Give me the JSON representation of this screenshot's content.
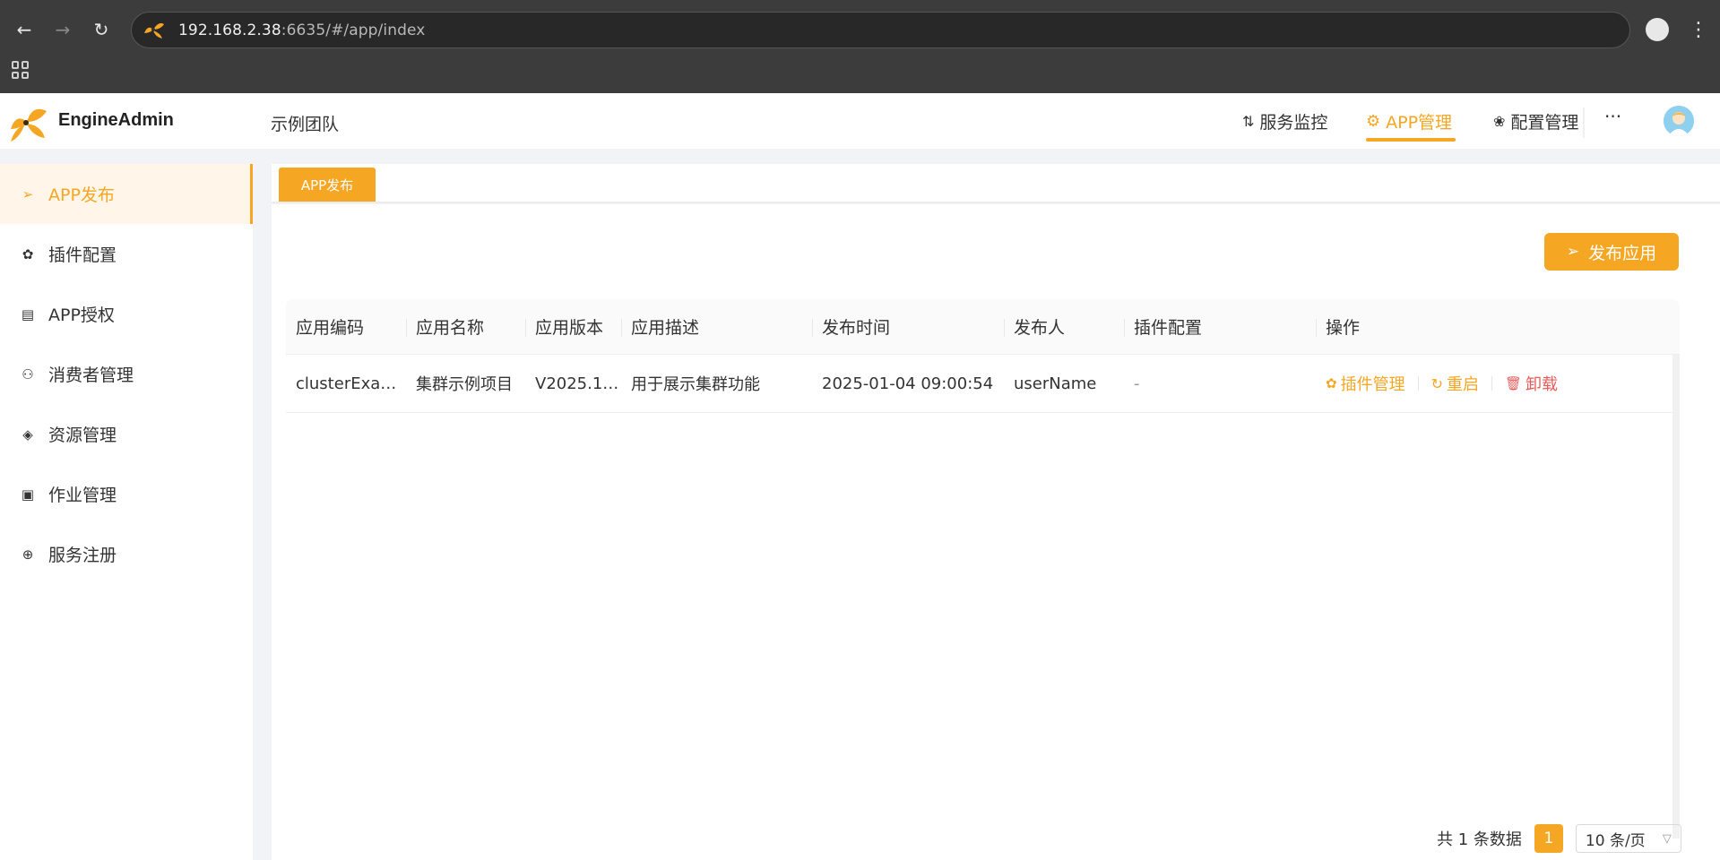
{
  "browser": {
    "url_host": "192.168.2.38",
    "url_rest": ":6635/#/app/index"
  },
  "header": {
    "brand": "EngineAdmin",
    "team": "示例团队",
    "nav": [
      {
        "label": "服务监控"
      },
      {
        "label": "APP管理"
      },
      {
        "label": "配置管理"
      }
    ],
    "more": "···"
  },
  "sidebar": {
    "items": [
      {
        "label": "APP发布",
        "icon": "send-icon"
      },
      {
        "label": "插件配置",
        "icon": "plugin-icon"
      },
      {
        "label": "APP授权",
        "icon": "license-icon"
      },
      {
        "label": "消费者管理",
        "icon": "consumer-icon"
      },
      {
        "label": "资源管理",
        "icon": "layers-icon"
      },
      {
        "label": "作业管理",
        "icon": "job-icon"
      },
      {
        "label": "服务注册",
        "icon": "user-add-icon"
      }
    ]
  },
  "tabs": {
    "active": "APP发布"
  },
  "toolbar": {
    "publish_label": "发布应用"
  },
  "table": {
    "headers": [
      "应用编码",
      "应用名称",
      "应用版本",
      "应用描述",
      "发布时间",
      "发布人",
      "插件配置",
      "操作"
    ],
    "rows": [
      {
        "code": "clusterExam...",
        "name": "集群示例项目",
        "version": "V2025.1....",
        "desc": "用于展示集群功能",
        "time": "2025-01-04 09:00:54",
        "publisher": "userName",
        "plugin": "-",
        "ops": {
          "plugin": "插件管理",
          "restart": "重启",
          "uninstall": "卸载"
        }
      }
    ]
  },
  "pager": {
    "total": "共 1 条数据",
    "page": "1",
    "size": "10 条/页"
  },
  "colors": {
    "accent": "#f5a623",
    "danger": "#e85c5c"
  }
}
